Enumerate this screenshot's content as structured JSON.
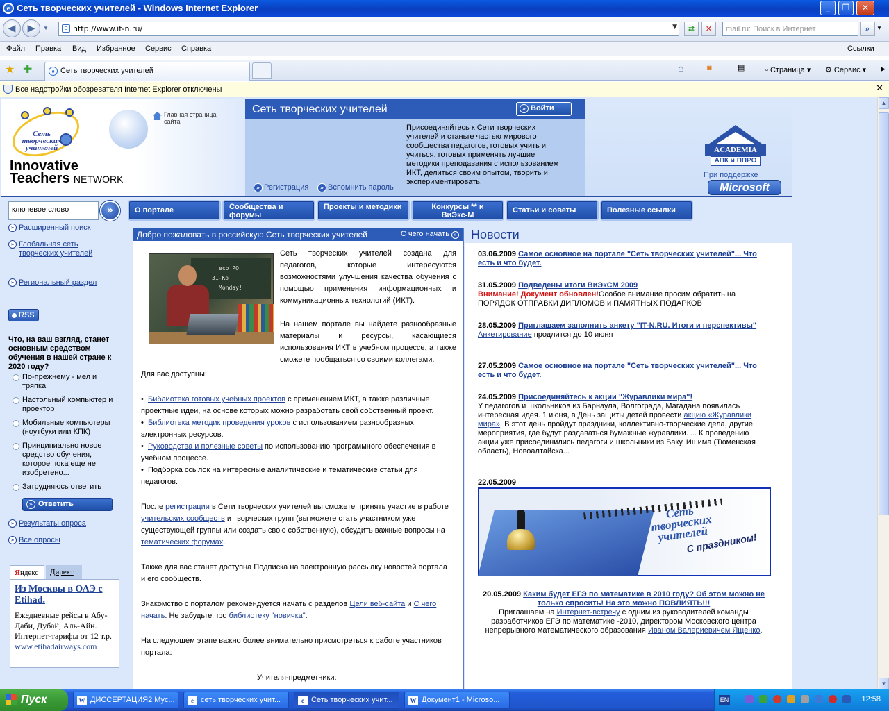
{
  "window": {
    "title": "Сеть творческих учителей - Windows Internet Explorer"
  },
  "address": {
    "url": "http://www.it-n.ru/",
    "search_placeholder": "mail.ru: Поиск в Интернет"
  },
  "menu": [
    "Файл",
    "Правка",
    "Вид",
    "Избранное",
    "Сервис",
    "Справка"
  ],
  "menu_right": "Ссылки",
  "tab": {
    "label": "Сеть творческих учителей"
  },
  "tools": {
    "page": "Страница",
    "service": "Сервис"
  },
  "infobar": "Все надстройки обозревателя Internet Explorer отключены",
  "header": {
    "logo_text": "Сеть творческих учителей",
    "brand_line1": "Innovative",
    "brand_line2": "Teachers",
    "brand_line2_suffix": "NETWORK",
    "home_link": "Главная страница сайта",
    "site_title": "Сеть творческих учителей",
    "login": "Войти",
    "join_text": "Присоединяйтесь к Сети творческих учителей и станьте частью мирового сообщества педагогов, готовых учить и учиться, готовых применять лучшие методики преподавания с использованием ИКТ, делиться своим опытом, творить и экспериментировать.",
    "register": "Регистрация",
    "forgot": "Вспомнить пароль",
    "academia": "ACADEMIA",
    "academia_sub": "АПК и ППРО",
    "support": "При поддержке",
    "microsoft": "Microsoft"
  },
  "nav": {
    "search_value": "ключевое слово",
    "tabs": [
      "О портале",
      "Сообщества и форумы",
      "Проекты и методики",
      "Конкурсы ** и ВиЭкс-М",
      "Статьи и советы",
      "Полезные ссылки"
    ]
  },
  "sidebar": {
    "links": [
      "Расширенный поиск",
      "Глобальная сеть творческих учителей",
      "Региональный раздел"
    ],
    "rss": "RSS",
    "poll_question": "Что, на ваш взгляд, станет основным средством обучения в нашей стране к 2020 году?",
    "poll_options": [
      "По-прежнему - мел и тряпка",
      "Настольный компьютер и проектор",
      "Мобильные компьютеры (ноутбуки или КПК)",
      "Принципиально новое средство обучения, которое пока еще не изобретено...",
      "Затрудняюсь ответить"
    ],
    "answer": "Ответить",
    "results": "Результаты опроса",
    "all_polls": "Все опросы",
    "ad_tab1_a": "Я",
    "ad_tab1_b": "ндекс",
    "ad_tab2": "Директ",
    "ad_title": "Из Москвы в ОАЭ с Etihad.",
    "ad_body": "Ежедневные рейсы в Абу-Даби, Дубай, Аль-Айн. Интернет-тарифы от 12 т.р.",
    "ad_url": "www.etihadairways.com"
  },
  "center": {
    "header": "Добро пожаловать в российскую Сеть творческих учителей",
    "start": "С чего начать",
    "p1": "Сеть творческих учителей создана для педагогов, которые интересуются возможностями улучшения качества обучения с помощью применения информационных и коммуникационных технологий (ИКТ).",
    "p2": "На нашем портале вы найдете разнообразные материалы и ресурсы, касающиеся использования ИКТ в учебном процессе, а также сможете пообщаться со своими коллегами.",
    "available": "Для вас доступны:",
    "b1_link": "Библиотека готовых учебных проектов",
    "b1_text": " с применением ИКТ, а также различные проектные идеи, на основе которых можно разработать свой собственный проект.",
    "b2_link": "Библиотека методик проведения уроков",
    "b2_text": " с использованием разнообразных электронных ресурсов.",
    "b3_link": "Руководства и полезные советы",
    "b3_text": " по использованию программного обеспечения в учебном процессе.",
    "b4_text": "Подборка ссылок на интересные аналитические и тематические статьи для педагогов.",
    "p3_a": "После ",
    "p3_link1": "регистрации",
    "p3_b": " в Сети творческих учителей вы сможете принять участие в работе ",
    "p3_link2": "учительских сообществ",
    "p3_c": " и творческих групп (вы можете стать участником уже существующей группы или создать свою собственную), обсудить важные вопросы на ",
    "p3_link3": "тематических форумах",
    "p3_d": ".",
    "p4": "Также для вас станет доступна Подписка на электронную рассылку новостей портала и его сообществ.",
    "p5_a": "Знакомство с порталом рекомендуется начать с разделов ",
    "p5_link1": "Цели веб-сайта",
    "p5_b": " и ",
    "p5_link2": "С чего начать",
    "p5_c": ". Не забудьте про ",
    "p5_link3": "библиотеку \"новичка\"",
    "p5_d": ".",
    "p6": "На следующем этапе важно более внимательно присмотреться к работе участников портала:",
    "p7": "Учителя-предметники:"
  },
  "news": {
    "title": "Новости",
    "items": [
      {
        "date": "03.06.2009",
        "title": "Самое основное на портале \"Сеть творческих учителей\"... Что есть и что будет."
      },
      {
        "date": "31.05.2009",
        "title": "Подведены итоги ВиЭкСМ 2009",
        "warn": "Внимание! Документ обновлен!",
        "text": "Особое внимание просим обратить на ПОРЯДОК ОТПРАВКИ ДИПЛОМОВ и ПАМЯТНЫХ ПОДАРКОВ"
      },
      {
        "date": "28.05.2009",
        "title": "Приглашаем заполнить анкету \"IT-N.RU. Итоги и перспективы\"",
        "link": "Анкетирование",
        "text": " продлится до 10 июня"
      },
      {
        "date": "27.05.2009",
        "title": "Самое основное на портале \"Сеть творческих учителей\"... Что есть и что будет."
      },
      {
        "date": "24.05.2009",
        "title": "Присоединяйтесь к акции \"Журавлики мира\"!",
        "text": "У педагогов и школьников из Барнаула, Волгограда, Магадана появилась интересная идея. 1 июня, в День защиты детей провести ",
        "link": "акцию «Журавлики мира»",
        "text2": ". В этот день пройдут праздники, коллективно-творческие дела, другие мероприятия, где будут раздаваться бумажные журавлики. ... К проведению акции уже присоединились педагоги и школьники из Баку, Ишима (Тюменская область), Новоалтайска..."
      },
      {
        "date": "22.05.2009"
      },
      {
        "date": "20.05.2009",
        "title": "Каким будет ЕГЭ по математике в 2010 году? Об этом можно не только спросить! На это можно ПОВЛИЯТЬ!!!",
        "text": "Приглашаем на ",
        "link": "Интернет-встречу",
        "text2": " с одним из руководителей команды разработчиков ЕГЭ по математике -2010, директором Московского центра непрерывного математического образования ",
        "link2": "Иваном Валериевичем Ященко",
        "text3": "."
      }
    ],
    "banner_logo": "Сеть творческих учителей",
    "banner_congrats": "С праздником!"
  },
  "taskbar": {
    "start": "Пуск",
    "tasks": [
      "ДИССЕРТАЦИЯ2 Мус...",
      "сеть творческих учит...",
      "Сеть творческих учит...",
      "Документ1 - Microso..."
    ],
    "lang": "EN",
    "clock": "12:58"
  }
}
